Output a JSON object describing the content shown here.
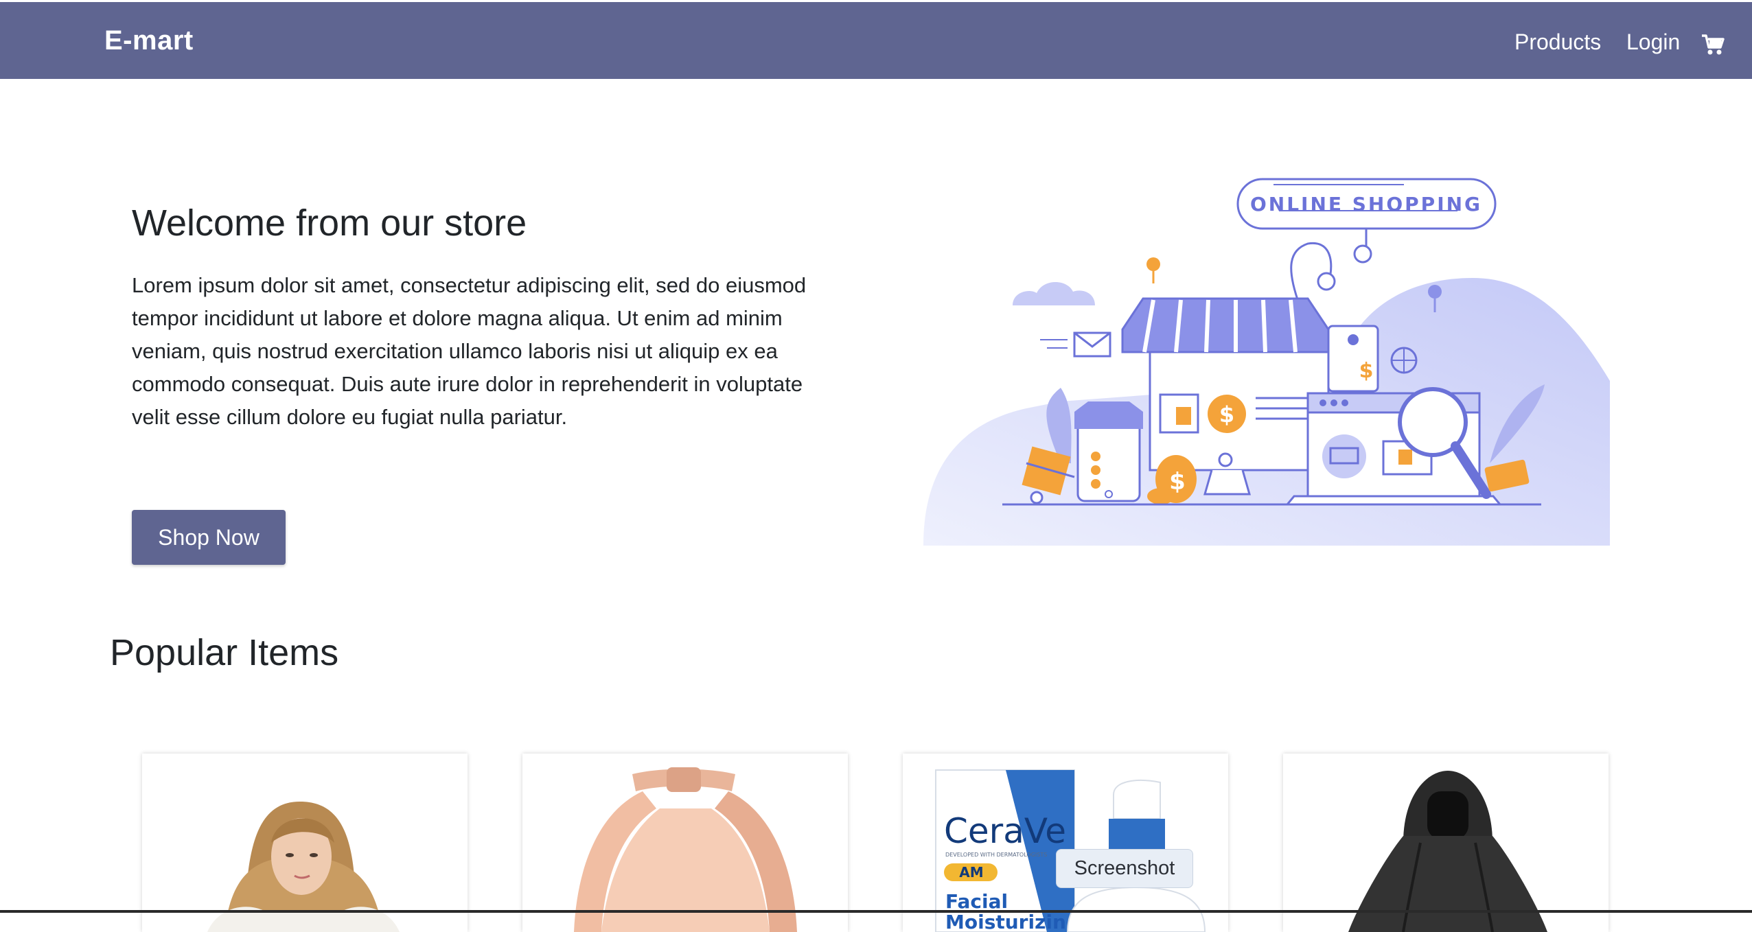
{
  "navbar": {
    "brand": "E-mart",
    "links": [
      "Products",
      "Login"
    ],
    "cart_icon": "cart-icon",
    "color": "#5f6591"
  },
  "hero": {
    "title": "Welcome from our store",
    "text": "Lorem ipsum dolor sit amet, consectetur adipiscing elit, sed do eiusmod tempor incididunt ut labore et dolore magna aliqua. Ut enim ad minim veniam, quis nostrud exercitation ullamco laboris nisi ut aliquip ex ea commodo consequat. Duis aute irure dolor in reprehenderit in voluptate velit esse cillum dolore eu fugiat nulla pariatur.",
    "button": "Shop Now",
    "illustration_label": "ONLINE SHOPPING"
  },
  "popular": {
    "title": "Popular Items",
    "items": [
      {
        "image": "woman-portrait"
      },
      {
        "image": "pink-handbag"
      },
      {
        "image": "cerave-moisturizer",
        "brand_text": "CeraVe",
        "badge_text": "AM",
        "product_text": "Facial Moisturizing",
        "tiny_text": "DEVELOPED WITH DERMATOLOGISTS"
      },
      {
        "image": "black-rain-poncho"
      }
    ]
  },
  "tooltip": "Screenshot",
  "colors": {
    "accent": "#5f6591",
    "illustration": "#6b72d8",
    "orange": "#f4a33a"
  }
}
